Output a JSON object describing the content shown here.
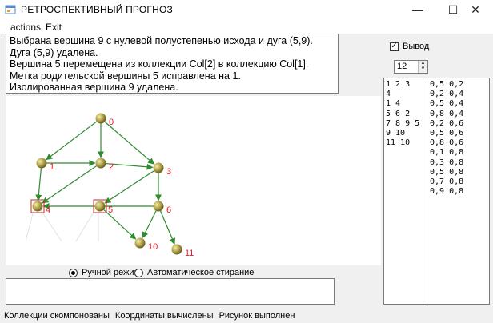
{
  "window": {
    "title": "РЕТРОСПЕКТИВНЫЙ ПРОГНОЗ",
    "minimize_glyph": "—",
    "maximize_glyph": "☐",
    "close_glyph": "✕"
  },
  "menu": {
    "items": [
      "actions",
      "Exit"
    ]
  },
  "log": {
    "lines": [
      "Выбрана вершина 9  с нулевой полустепенью исхода и дуга (5,9).",
      "Дуга (5,9) удалена.",
      "Вершина  5  перемещена из коллекции Col[2] в коллекцию Col[1].",
      "Метка родительской вершины 5 исправлена на 1.",
      "Изолированная вершина 9 удалена."
    ]
  },
  "graph": {
    "edge_color": "#2e8b2e",
    "node_color": "#b5a64a",
    "label_color": "#e0202a",
    "highlight_color": "#c0282a",
    "nodes": [
      {
        "label": "0",
        "highlight": false
      },
      {
        "label": "1",
        "highlight": false
      },
      {
        "label": "2",
        "highlight": false
      },
      {
        "label": "3",
        "highlight": false
      },
      {
        "label": "4",
        "highlight": true
      },
      {
        "label": "5",
        "highlight": true
      },
      {
        "label": "6",
        "highlight": false
      },
      {
        "label": "10",
        "highlight": false
      },
      {
        "label": "11",
        "highlight": false
      }
    ],
    "edges": [
      [
        "0",
        "1"
      ],
      [
        "0",
        "2"
      ],
      [
        "0",
        "3"
      ],
      [
        "1",
        "2"
      ],
      [
        "1",
        "4"
      ],
      [
        "2",
        "3"
      ],
      [
        "2",
        "4"
      ],
      [
        "3",
        "5"
      ],
      [
        "3",
        "6"
      ],
      [
        "6",
        "4"
      ],
      [
        "5",
        "10"
      ],
      [
        "6",
        "10"
      ],
      [
        "6",
        "11"
      ]
    ]
  },
  "radios": [
    {
      "label": "Ручной режим",
      "checked": true
    },
    {
      "label": "Автоматическое стирание",
      "checked": false
    }
  ],
  "status": [
    "Коллекции скомпонованы",
    "Координаты вычислены",
    "Рисунок выполнен"
  ],
  "right_panel": {
    "output_checkbox": {
      "label": "Вывод",
      "checked": true
    },
    "spinner_value": "12",
    "list_left": [
      "1 2 3",
      "4",
      "1 4",
      "5 6 2",
      "7 8 9 5",
      "9 10",
      "11 10"
    ],
    "list_right": [
      "0,5 0,2",
      "0,2 0,4",
      "0,5 0,4",
      "0,8 0,4",
      "0,2 0,6",
      "0,5 0,6",
      "0,8 0,6",
      "0,1 0,8",
      "0,3 0,8",
      "0,5 0,8",
      "0,7 0,8",
      "0,9 0,8"
    ]
  }
}
